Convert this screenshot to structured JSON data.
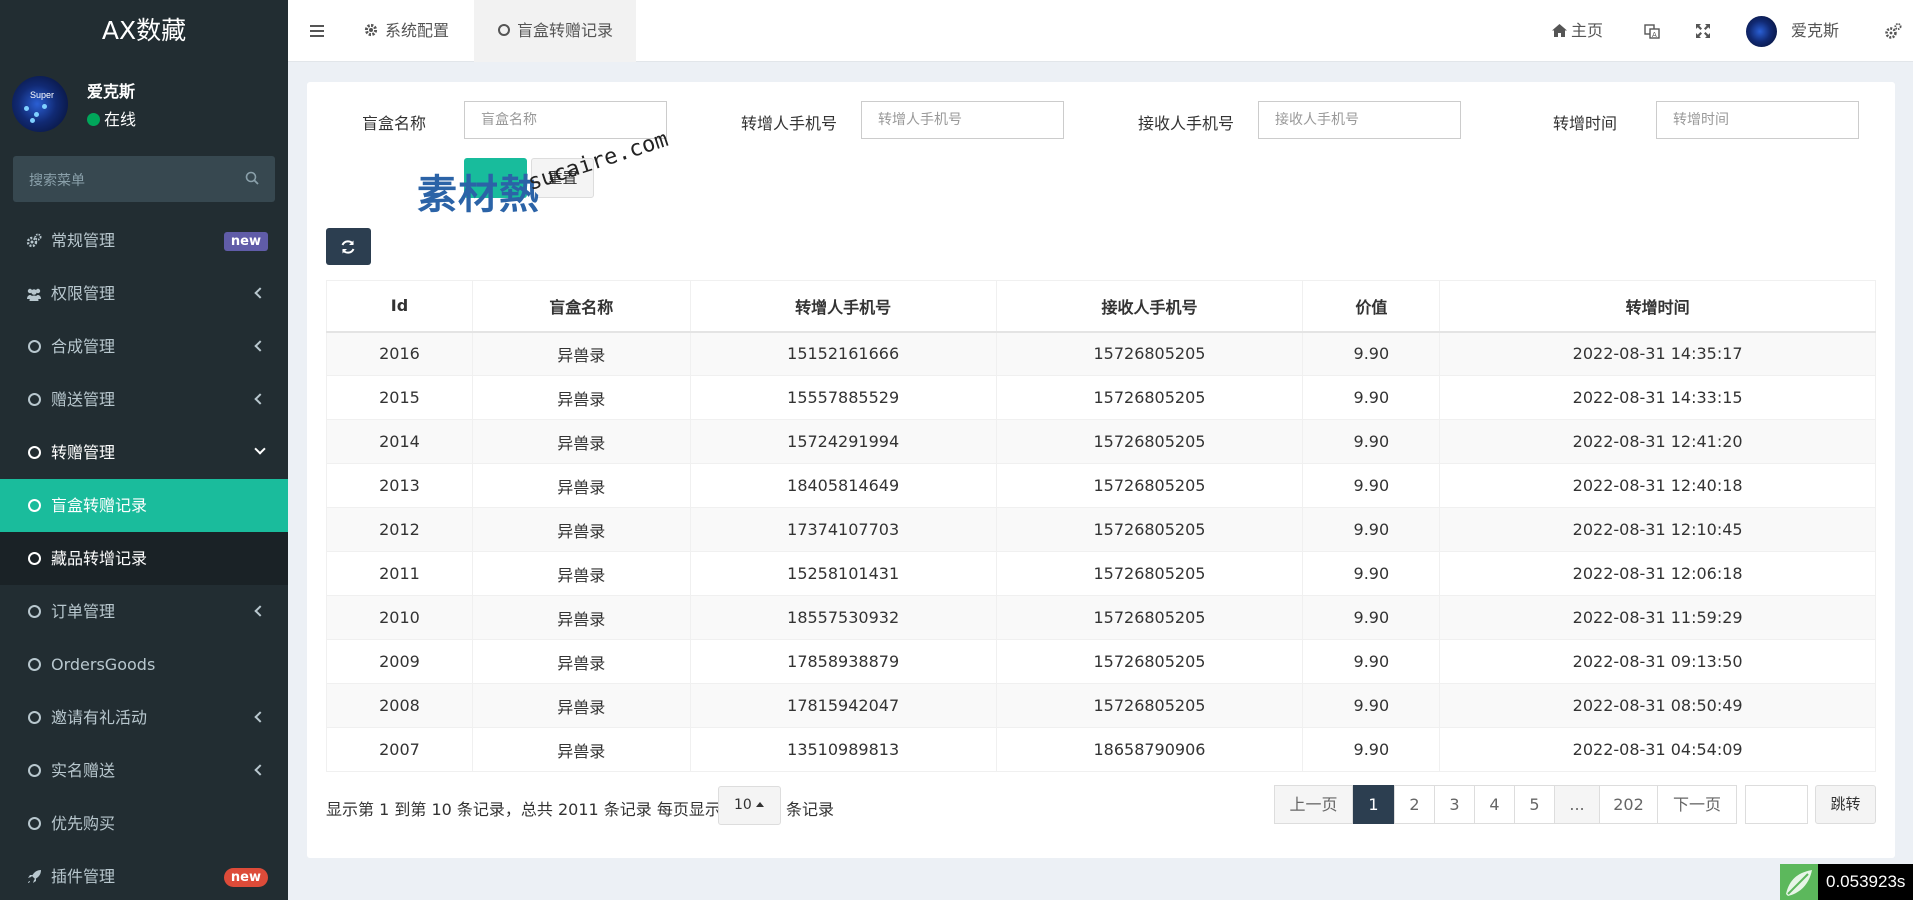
{
  "brand": "AX数藏",
  "user": {
    "name": "爱克斯",
    "status": "在线"
  },
  "sidebar": {
    "search_placeholder": "搜索菜单",
    "items": [
      {
        "label": "常规管理",
        "badge": "new"
      },
      {
        "label": "权限管理"
      },
      {
        "label": "合成管理"
      },
      {
        "label": "赠送管理"
      },
      {
        "label": "转赠管理"
      },
      {
        "label": "盲盒转赠记录"
      },
      {
        "label": "藏品转增记录"
      },
      {
        "label": "订单管理"
      },
      {
        "label": "OrdersGoods"
      },
      {
        "label": "邀请有礼活动"
      },
      {
        "label": "实名赠送"
      },
      {
        "label": "优先购买"
      },
      {
        "label": "插件管理",
        "badge": "new"
      }
    ]
  },
  "topnav": {
    "tabs": [
      {
        "label": "系统配置"
      },
      {
        "label": "盲盒转赠记录"
      }
    ],
    "home": "主页",
    "user_name": "爱克斯"
  },
  "filters": [
    {
      "label": "盲盒名称",
      "placeholder": "盲盒名称"
    },
    {
      "label": "转增人手机号",
      "placeholder": "转增人手机号"
    },
    {
      "label": "接收人手机号",
      "placeholder": "接收人手机号"
    },
    {
      "label": "转增时间",
      "placeholder": "转增时间"
    }
  ],
  "buttons": {
    "reset": "重置"
  },
  "watermark": {
    "brand": "素材熱",
    "url": "sucaire.com"
  },
  "table": {
    "headers": [
      "Id",
      "盲盒名称",
      "转增人手机号",
      "接收人手机号",
      "价值",
      "转增时间"
    ],
    "rows": [
      [
        "2016",
        "异兽录",
        "15152161666",
        "15726805205",
        "9.90",
        "2022-08-31 14:35:17"
      ],
      [
        "2015",
        "异兽录",
        "15557885529",
        "15726805205",
        "9.90",
        "2022-08-31 14:33:15"
      ],
      [
        "2014",
        "异兽录",
        "15724291994",
        "15726805205",
        "9.90",
        "2022-08-31 12:41:20"
      ],
      [
        "2013",
        "异兽录",
        "18405814649",
        "15726805205",
        "9.90",
        "2022-08-31 12:40:18"
      ],
      [
        "2012",
        "异兽录",
        "17374107703",
        "15726805205",
        "9.90",
        "2022-08-31 12:10:45"
      ],
      [
        "2011",
        "异兽录",
        "15258101431",
        "15726805205",
        "9.90",
        "2022-08-31 12:06:18"
      ],
      [
        "2010",
        "异兽录",
        "18557530932",
        "15726805205",
        "9.90",
        "2022-08-31 11:59:29"
      ],
      [
        "2009",
        "异兽录",
        "17858938879",
        "15726805205",
        "9.90",
        "2022-08-31 09:13:50"
      ],
      [
        "2008",
        "异兽录",
        "17815942047",
        "15726805205",
        "9.90",
        "2022-08-31 08:50:49"
      ],
      [
        "2007",
        "异兽录",
        "13510989813",
        "18658790906",
        "9.90",
        "2022-08-31 04:54:09"
      ]
    ]
  },
  "pagination": {
    "info": "显示第 1 到第 10 条记录，总共 2011 条记录 每页显示",
    "page_size": "10",
    "suffix": "条记录",
    "prev": "上一页",
    "pages": [
      "1",
      "2",
      "3",
      "4",
      "5",
      "...",
      "202"
    ],
    "next": "下一页",
    "jump": "跳转"
  },
  "timer": "0.053923s",
  "colors": {
    "sidebar_bg": "#222d32",
    "active": "#1abc9c",
    "primary": "#2c3e50",
    "badge_new": "#605ca8",
    "badge_new_red": "#dd4b39"
  }
}
